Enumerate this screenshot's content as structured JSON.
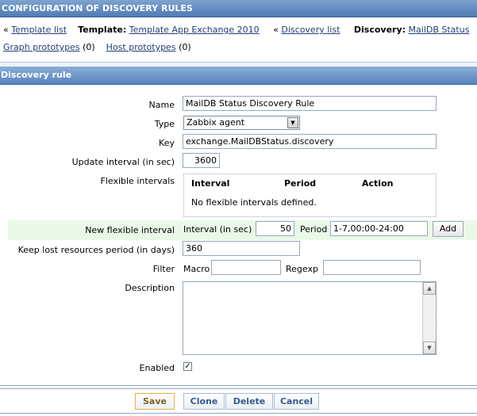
{
  "header": {
    "title": "CONFIGURATION OF DISCOVERY RULES"
  },
  "nav": {
    "template_list_link": "Template list",
    "template_label": "Template:",
    "template_link": "Template App Exchange 2010",
    "discovery_list_link": "Discovery list",
    "discovery_label": "Discovery:",
    "discovery_link": "MailDB Status",
    "back_marker": "«",
    "graph_prototypes_link": "Graph prototypes",
    "graph_prototypes_count": "(0)",
    "host_prototypes_link": "Host prototypes",
    "host_prototypes_count": "(0)"
  },
  "section": {
    "title": "Discovery rule"
  },
  "form": {
    "name_label": "Name",
    "name_value": "MailDB Status Discovery Rule",
    "type_label": "Type",
    "type_value": "Zabbix agent",
    "key_label": "Key",
    "key_value": "exchange.MailDBStatus.discovery",
    "update_interval_label": "Update interval (in sec)",
    "update_interval_value": "3600",
    "flexible_intervals_label": "Flexible intervals",
    "flex_col_interval": "Interval",
    "flex_col_period": "Period",
    "flex_col_action": "Action",
    "flex_empty": "No flexible intervals defined.",
    "new_flex_label": "New flexible interval",
    "new_flex_interval_label": "Interval (in sec)",
    "new_flex_interval_value": "50",
    "new_flex_period_label": "Period",
    "new_flex_period_value": "1-7,00:00-24:00",
    "add_button": "Add",
    "keep_lost_label": "Keep lost resources period (in days)",
    "keep_lost_value": "360",
    "filter_label": "Filter",
    "macro_label": "Macro",
    "macro_value": "",
    "regexp_label": "Regexp",
    "regexp_value": "",
    "description_label": "Description",
    "description_value": "",
    "enabled_label": "Enabled",
    "enabled_checked": "✓"
  },
  "footer": {
    "save": "Save",
    "clone": "Clone",
    "delete": "Delete",
    "cancel": "Cancel"
  },
  "colors": {
    "header_bg": "#4f7bb5",
    "link": "#1f3f7a",
    "row_highlight": "#eaf8e8",
    "save_border": "#f0b040"
  }
}
